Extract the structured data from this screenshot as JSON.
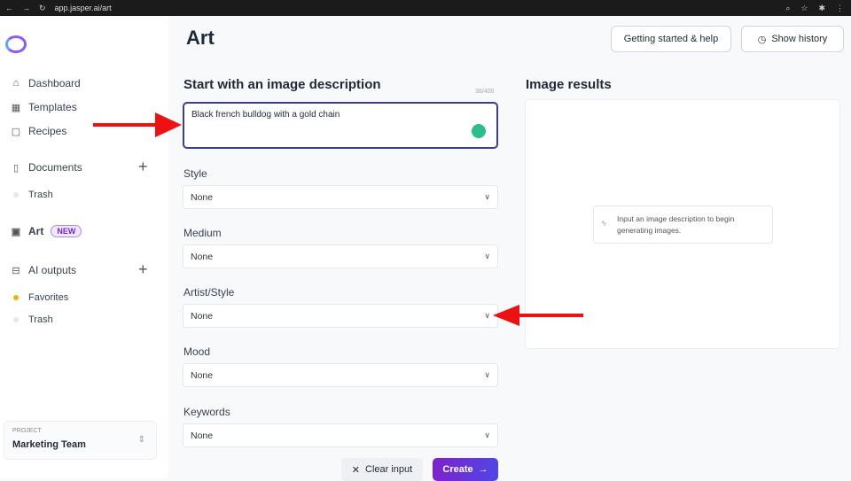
{
  "browser": {
    "url": "app.jasper.ai/art"
  },
  "sidebar": {
    "items": [
      {
        "label": "Dashboard",
        "icon": "home-icon"
      },
      {
        "label": "Templates",
        "icon": "grid-icon"
      },
      {
        "label": "Recipes",
        "icon": "recipe-icon"
      },
      {
        "label": "Documents",
        "icon": "document-icon"
      },
      {
        "label": "Trash"
      },
      {
        "label": "Art",
        "icon": "image-icon",
        "badge": "NEW"
      },
      {
        "label": "AI outputs",
        "icon": "inbox-icon"
      },
      {
        "label": "Favorites"
      },
      {
        "label": "Trash"
      }
    ],
    "project": {
      "label": "PROJECT",
      "name": "Marketing Team"
    }
  },
  "header": {
    "title": "Art",
    "help": "Getting started & help",
    "history": "Show history"
  },
  "form": {
    "heading": "Start with an image description",
    "counter": "38/400",
    "description": "Black french bulldog with a gold chain",
    "fields": [
      {
        "label": "Style",
        "value": "None"
      },
      {
        "label": "Medium",
        "value": "None"
      },
      {
        "label": "Artist/Style",
        "value": "None"
      },
      {
        "label": "Mood",
        "value": "None"
      },
      {
        "label": "Keywords",
        "value": "None"
      }
    ],
    "clear": "Clear input",
    "create": "Create"
  },
  "results": {
    "heading": "Image results",
    "hint": "Input an image description to begin generating images."
  },
  "colors": {
    "accent": "#7e22ce",
    "annotation_arrow": "#e11111"
  }
}
